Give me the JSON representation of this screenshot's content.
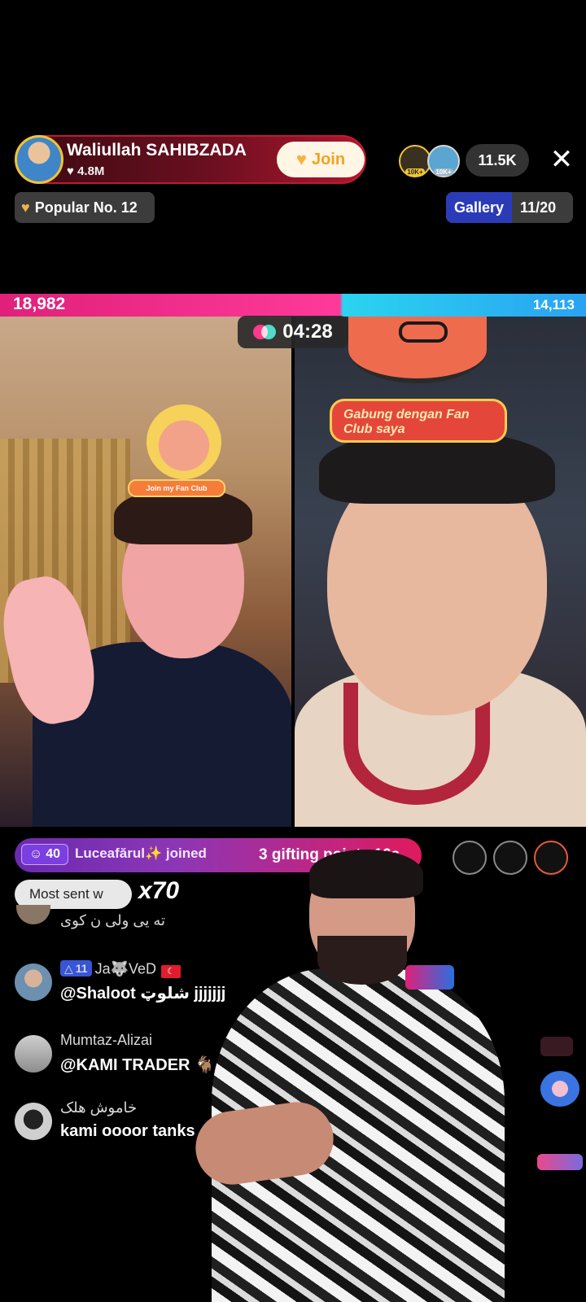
{
  "host": {
    "name": "Waliullah SAHIBZADA",
    "likes": "4.8M",
    "join_label": "Join"
  },
  "viewers": {
    "badge1": "10K+",
    "badge2": "10K+",
    "count": "11.5K"
  },
  "close_label": "✕",
  "popular": {
    "label": "Popular No. 12"
  },
  "gallery": {
    "label": "Gallery",
    "count": "11/20"
  },
  "battle": {
    "left_score": "18,982",
    "right_score": "14,113",
    "timer": "04:28"
  },
  "stickers": {
    "left_fanclub": "Join my Fan Club",
    "right_fanclub": "Gabung dengan Fan Club saya"
  },
  "banner": {
    "level": "40",
    "joined": "Luceafărul✨ joined",
    "gifting": "3 gifting points  16s"
  },
  "most_sent": {
    "label": "Most sent w",
    "multiplier": "x70"
  },
  "chat": {
    "previous_message": "ته یی ولی ن کوی",
    "messages": [
      {
        "user": "Ja🐺VeD",
        "level": "11",
        "message": "@Shaloot شلوټ jjjjjjj"
      },
      {
        "user": "Mumtaz-Alizai",
        "message": "@KAMI TRADER 🐐"
      },
      {
        "user": "خاموش هلک",
        "message": "kami oooor tanks"
      }
    ]
  },
  "colors": {
    "battle_left": "#e0207a",
    "battle_right": "#2aa2f2",
    "join_text": "#f2a31f",
    "level_badge": "#7b3ee0"
  }
}
